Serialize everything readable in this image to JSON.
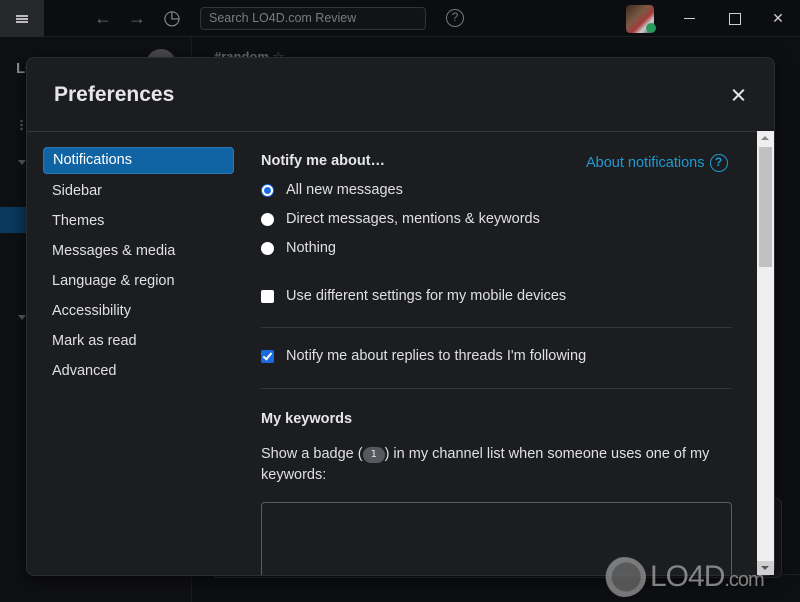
{
  "titlebar": {
    "search_placeholder": "Search LO4D.com Review",
    "icons": [
      "menu-icon",
      "back-arrow-icon",
      "forward-arrow-icon",
      "history-clock-icon",
      "help-icon",
      "user-avatar",
      "minimize-icon",
      "maximize-icon",
      "close-icon"
    ],
    "back_glyph": "←",
    "forward_glyph": "→",
    "history_glyph": "◷",
    "help_glyph": "?",
    "close_glyph": "✕"
  },
  "background": {
    "workspace_label": "LO",
    "channel_name": "#random ☆"
  },
  "modal": {
    "title": "Preferences",
    "nav": [
      {
        "label": "Notifications",
        "active": true
      },
      {
        "label": "Sidebar",
        "active": false
      },
      {
        "label": "Themes",
        "active": false
      },
      {
        "label": "Messages & media",
        "active": false
      },
      {
        "label": "Language & region",
        "active": false
      },
      {
        "label": "Accessibility",
        "active": false
      },
      {
        "label": "Mark as read",
        "active": false
      },
      {
        "label": "Advanced",
        "active": false
      }
    ],
    "notifications": {
      "heading": "Notify me about…",
      "about_link": "About notifications",
      "about_icon": "?",
      "radio_options": [
        {
          "label": "All new messages",
          "selected": true
        },
        {
          "label": "Direct messages, mentions & keywords",
          "selected": false
        },
        {
          "label": "Nothing",
          "selected": false
        }
      ],
      "mobile_checkbox": {
        "label": "Use different settings for my mobile devices",
        "checked": false
      },
      "threads_checkbox": {
        "label": "Notify me about replies to threads I'm following",
        "checked": true
      },
      "keywords_heading": "My keywords",
      "keywords_desc_before": "Show a badge (",
      "keywords_badge": "1",
      "keywords_desc_after": ") in my channel list when someone uses one of my keywords:",
      "keywords_value": ""
    }
  },
  "watermark": {
    "text": "LO4D",
    "suffix": ".com"
  },
  "colors": {
    "accent": "#1164a3",
    "link": "#1d9bd1",
    "checkbox": "#1a6be0",
    "modal_bg": "#1b1d21"
  }
}
